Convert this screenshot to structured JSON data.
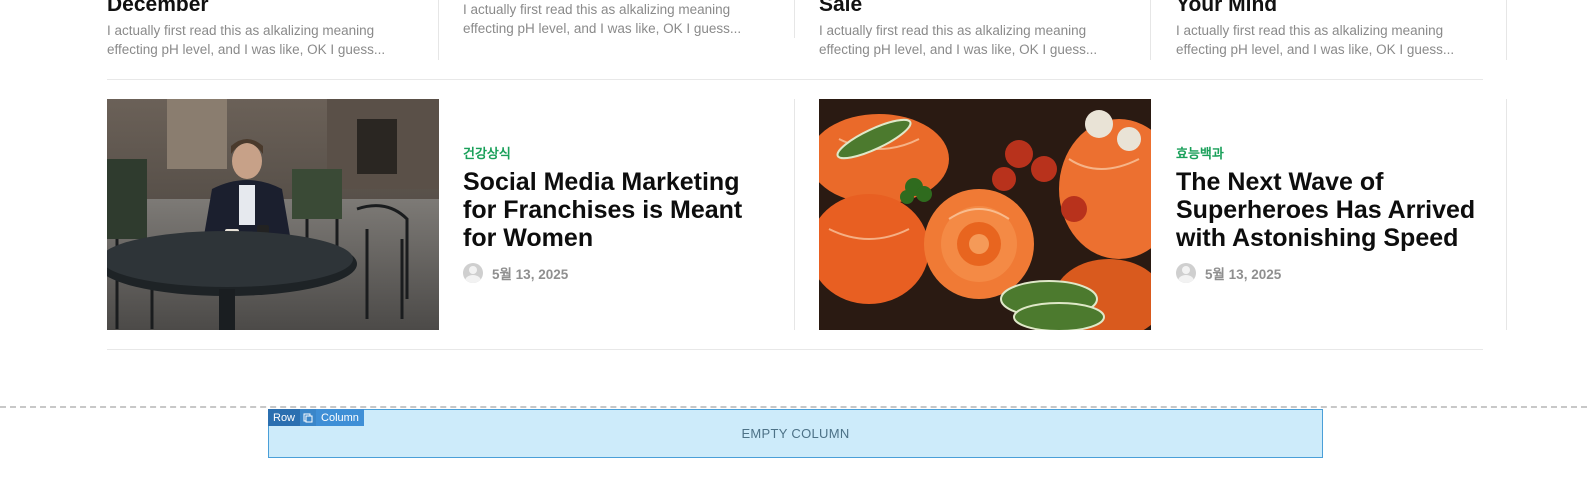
{
  "top_row": [
    {
      "title": "December",
      "excerpt": "I actually first read this as alkalizing meaning effecting pH level, and I was like, OK I guess..."
    },
    {
      "title": "",
      "excerpt": "I actually first read this as alkalizing meaning effecting pH level, and I was like, OK I guess..."
    },
    {
      "title": "Sale",
      "excerpt": "I actually first read this as alkalizing meaning effecting pH level, and I was like, OK I guess..."
    },
    {
      "title": "Your Mind",
      "excerpt": "I actually first read this as alkalizing meaning effecting pH level, and I was like, OK I guess..."
    }
  ],
  "posts": [
    {
      "category": "건강상식",
      "title": "Social Media Marketing for Franchises is Meant for Women",
      "date": "5월 13, 2025",
      "image": "man-cafe-photo"
    },
    {
      "category": "효능백과",
      "title": "The Next Wave of Superheroes Has Arrived with Astonishing Speed",
      "date": "5월 13, 2025",
      "image": "salmon-sushi-photo"
    }
  ],
  "builder": {
    "row_label": "Row",
    "column_label": "Column",
    "copy_icon": "copy-icon",
    "empty_column_text": "EMPTY COLUMN"
  },
  "colors": {
    "category": "#1aa05a",
    "empty_column_bg": "#cdebfa",
    "empty_column_border": "#4a9fd8"
  }
}
